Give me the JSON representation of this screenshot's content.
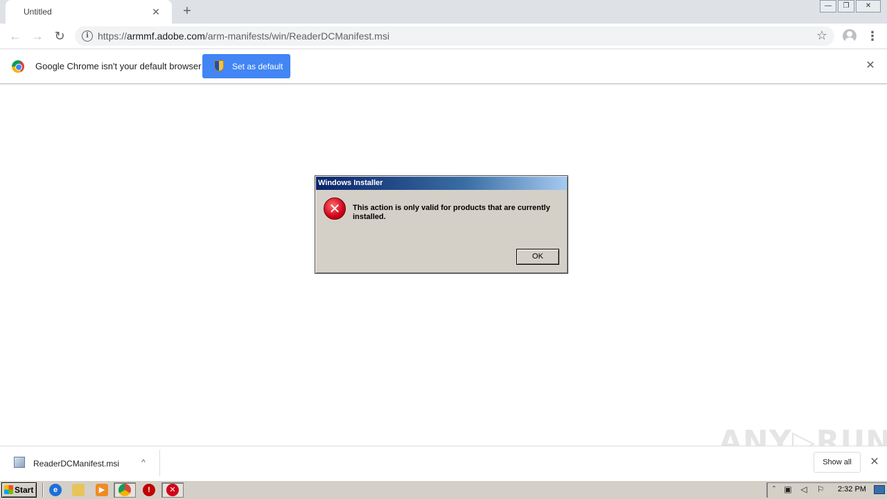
{
  "browser": {
    "tab_title": "Untitled",
    "tab_close_glyph": "✕",
    "new_tab_glyph": "+",
    "window_controls": {
      "minimize": "—",
      "restore": "❐",
      "close": "✕"
    },
    "nav": {
      "back": "←",
      "forward": "→",
      "reload": "↻"
    },
    "url_prefix": "https://",
    "url_host": "armmf.adobe.com",
    "url_path": "/arm-manifests/win/ReaderDCManifest.msi",
    "star_glyph": "☆",
    "menu_glyph": "⋮"
  },
  "infobar": {
    "message": "Google Chrome isn't your default browser",
    "button_label": "Set as default",
    "close_glyph": "✕"
  },
  "dialog": {
    "title": "Windows Installer",
    "message": "This action is only valid for products that are currently installed.",
    "error_glyph": "✕",
    "ok_label": "OK"
  },
  "watermark": "ANY▷RUN",
  "download_shelf": {
    "file_name": "ReaderDCManifest.msi",
    "chevron_glyph": "^",
    "show_all_label": "Show all",
    "close_glyph": "✕"
  },
  "taskbar": {
    "start_label": "Start",
    "clock": "2:32 PM",
    "tray_glyphs": {
      "arrow": "ˆ",
      "network": "▣",
      "volume": "◁",
      "flag": "⚐"
    }
  },
  "icons": [
    "info-icon",
    "star-icon",
    "profile-icon",
    "menu-icon",
    "chrome-logo-icon",
    "shield-icon",
    "error-icon",
    "msi-file-icon",
    "ie-icon",
    "explorer-icon",
    "media-player-icon",
    "chrome-icon",
    "stop-icon",
    "installer-error-icon"
  ],
  "colors": {
    "accent": "#4285f4",
    "dialog_bg": "#d4d0c8",
    "title_bar": "#0a246a",
    "error_red": "#d0021b"
  }
}
